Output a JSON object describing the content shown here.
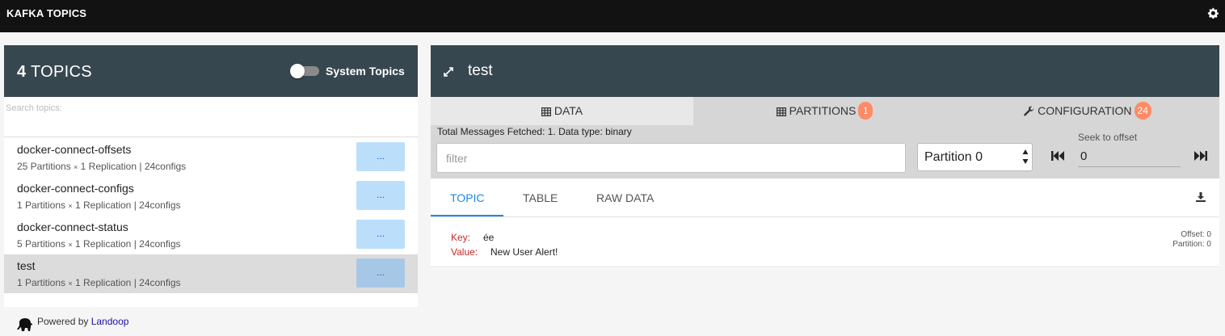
{
  "app": {
    "title": "KAFKA TOPICS",
    "settings_icon": "gear-icon"
  },
  "topics_panel": {
    "count": "4",
    "label": "TOPICS",
    "system_toggle": {
      "label": "System Topics",
      "on": false
    },
    "search": {
      "placeholder": "Search topics:",
      "value": ""
    },
    "items": [
      {
        "name": "docker-connect-offsets",
        "partitions": "25 Partitions",
        "times": "×",
        "detail": "1 Replication | 24configs",
        "button": "...",
        "selected": false
      },
      {
        "name": "docker-connect-configs",
        "partitions": "1 Partitions",
        "times": "×",
        "detail": "1 Replication | 24configs",
        "button": "...",
        "selected": false
      },
      {
        "name": "docker-connect-status",
        "partitions": "5 Partitions",
        "times": "×",
        "detail": "1 Replication | 24configs",
        "button": "...",
        "selected": false
      },
      {
        "name": "test",
        "partitions": "1 Partitions",
        "times": "×",
        "detail": "1 Replication | 24configs",
        "button": "...",
        "selected": true
      }
    ]
  },
  "footer": {
    "powered_by": "Powered by ",
    "link": "Landoop"
  },
  "detail": {
    "title": "test",
    "tabs": [
      {
        "label": "DATA",
        "icon": "table-icon",
        "badge": ""
      },
      {
        "label": "PARTITIONS",
        "icon": "table-icon",
        "badge": "1"
      },
      {
        "label": "CONFIGURATION",
        "icon": "wrench-icon",
        "badge": "24"
      }
    ],
    "fetched_text": "Total Messages Fetched: 1. Data type: binary",
    "filter": {
      "placeholder": "filter",
      "value": ""
    },
    "partition_select": {
      "value": "Partition 0"
    },
    "seek": {
      "label": "Seek to offset",
      "value": "0"
    },
    "subtabs": [
      "TOPIC",
      "TABLE",
      "RAW DATA"
    ],
    "message": {
      "key_label": "Key:",
      "key": "ée",
      "value_label": "Value:",
      "value": "New User Alert!",
      "offset": "Offset: 0",
      "partition": "Partition: 0"
    }
  },
  "colors": {
    "header_bg": "#37474f",
    "badge": "#ff8a65",
    "accent": "#1e88e5",
    "key_label": "#c62828"
  }
}
